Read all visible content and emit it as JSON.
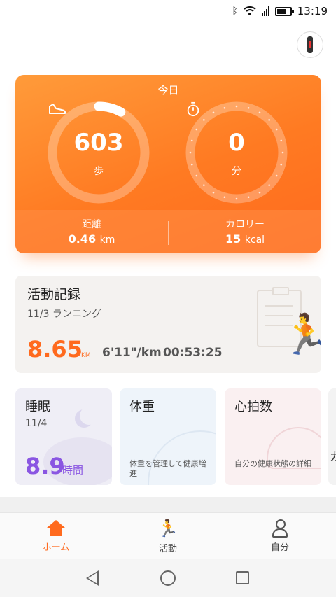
{
  "status_bar": {
    "time": "13:19"
  },
  "today_card": {
    "title": "今日",
    "steps": {
      "value": "603",
      "unit": "歩",
      "progress": 0.08
    },
    "active_minutes": {
      "value": "0",
      "unit": "分"
    },
    "distance": {
      "label": "距離",
      "value": "0.46",
      "unit": "km"
    },
    "calories": {
      "label": "カロリー",
      "value": "15",
      "unit": "kcal"
    },
    "accent_color": "#ff7a22"
  },
  "activity_card": {
    "title": "活動記録",
    "date_type": "11/3  ランニング",
    "distance_value": "8.65",
    "distance_unit": "KM",
    "pace": "6'11\"/km",
    "duration": "00:53:25"
  },
  "cards": {
    "sleep": {
      "title": "睡眠",
      "date": "11/4",
      "value": "8.9",
      "unit": "時間",
      "color": "#8a56e2"
    },
    "weight": {
      "title": "体重",
      "desc": "体重を管理して健康増進"
    },
    "heart": {
      "title": "心拍数",
      "desc": "自分の健康状態の詳細"
    },
    "partial": {
      "text": "カ"
    }
  },
  "tabbar": {
    "items": [
      {
        "label": "ホーム",
        "icon": "home-icon",
        "active": true
      },
      {
        "label": "活動",
        "icon": "running-icon",
        "active": false
      },
      {
        "label": "自分",
        "icon": "user-icon",
        "active": false
      }
    ]
  }
}
